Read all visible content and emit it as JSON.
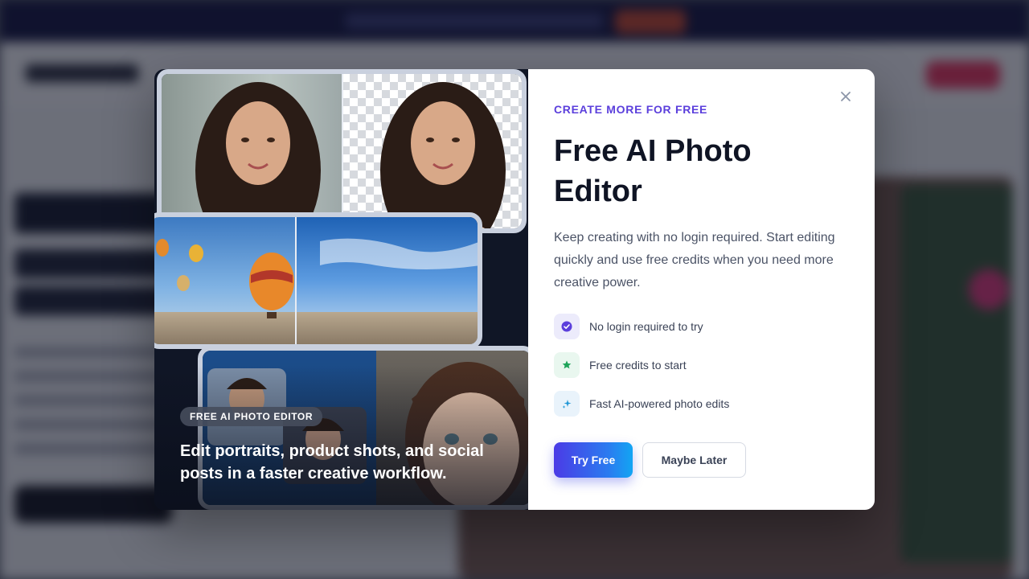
{
  "modal": {
    "media": {
      "badge": "FREE AI PHOTO EDITOR",
      "caption": "Edit portraits, product shots, and social posts in a faster creative workflow.",
      "images": [
        "portrait-background-removal",
        "hot-air-balloon-sky-replacement",
        "portrait-enhancement"
      ]
    },
    "eyebrow": "CREATE MORE FOR FREE",
    "title": "Free AI Photo Editor",
    "description": "Keep creating with no login required. Start editing quickly and use free credits when you need more creative power.",
    "features": [
      {
        "icon": "check-circle-icon",
        "label": "No login required to try",
        "color": "#5b3fdc"
      },
      {
        "icon": "star-icon",
        "label": "Free credits to start",
        "color": "#1fa45a"
      },
      {
        "icon": "sparkle-icon",
        "label": "Fast AI-powered photo edits",
        "color": "#1f97d6"
      }
    ],
    "buttons": {
      "primary": "Try Free",
      "secondary": "Maybe Later"
    },
    "close_icon": "close-icon"
  },
  "colors": {
    "accent": "#5b3fdc",
    "primary_gradient_start": "#4b3be6",
    "primary_gradient_end": "#12a5f3",
    "title": "#0f1424"
  }
}
